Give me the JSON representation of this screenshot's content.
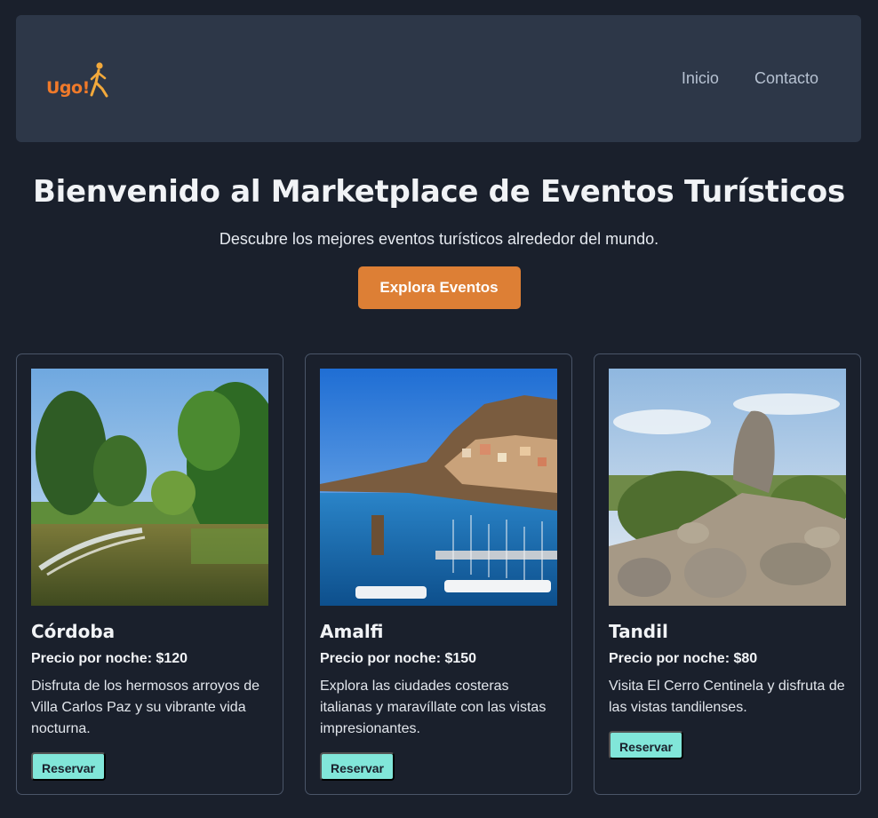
{
  "brand": {
    "logo_text": "Ugo!",
    "accent": "#f07a2a"
  },
  "nav": {
    "items": [
      "Inicio",
      "Contacto"
    ]
  },
  "hero": {
    "title": "Bienvenido al Marketplace de Eventos Turísticos",
    "subtitle": "Descubre los mejores eventos turísticos alrededor del mundo.",
    "cta_label": "Explora Eventos",
    "cta_color": "#dd7f35"
  },
  "cards": [
    {
      "name": "Córdoba",
      "price": "Precio por noche: $120",
      "description": "Disfruta de los hermosos arroyos de Villa Carlos Paz y su vibrante vida nocturna.",
      "button": "Reservar"
    },
    {
      "name": "Amalfi",
      "price": "Precio por noche: $150",
      "description": "Explora las ciudades costeras italianas y maravíllate con las vistas impresionantes.",
      "button": "Reservar"
    },
    {
      "name": "Tandil",
      "price": "Precio por noche: $80",
      "description": "Visita El Cerro Centinela y disfruta de las vistas tandilenses.",
      "button": "Reservar"
    }
  ],
  "colors": {
    "background": "#1a202c",
    "header": "#2d3748",
    "button_teal": "#81e6d9"
  }
}
